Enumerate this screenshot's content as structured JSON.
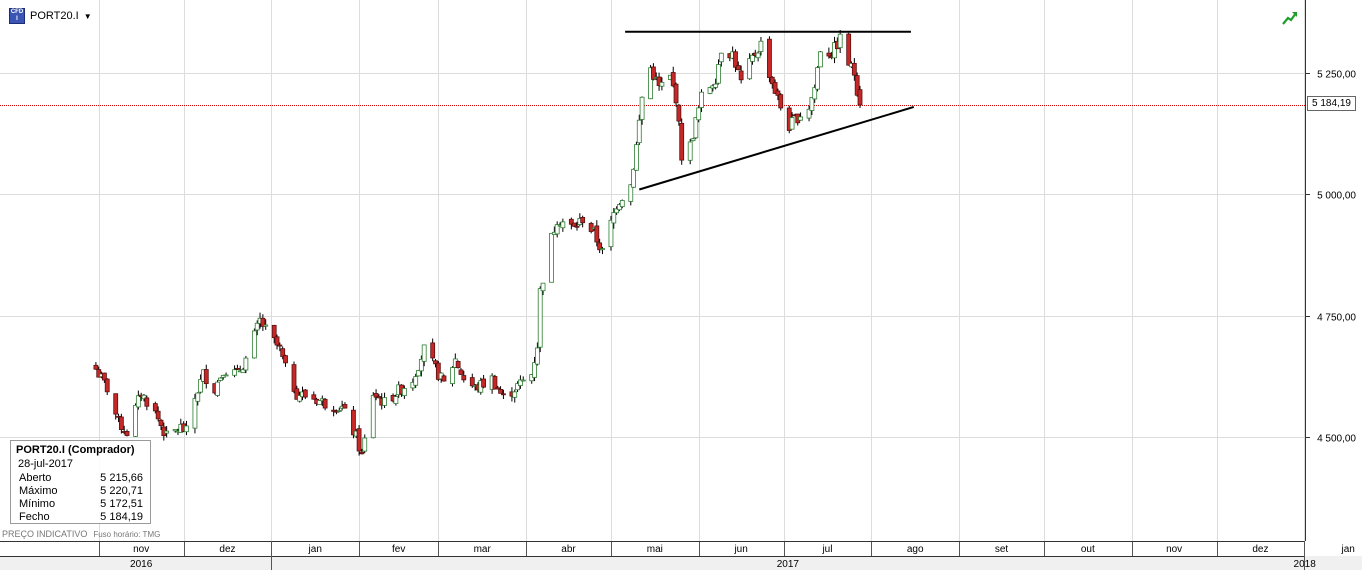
{
  "header": {
    "symbol": "PORT20.I",
    "icon": "cfd-instrument-icon",
    "caret": "▼"
  },
  "trend_icon": "green-trend-arrow-icon",
  "info_box": {
    "title": "PORT20.I (Comprador)",
    "date": "28-jul-2017",
    "rows": [
      {
        "label": "Aberto",
        "value": "5 215,66"
      },
      {
        "label": "Máximo",
        "value": "5 220,71"
      },
      {
        "label": "Mínimo",
        "value": "5 172,51"
      },
      {
        "label": "Fecho",
        "value": "5 184,19"
      }
    ]
  },
  "footer_note": "PREÇO INDICATIVO",
  "timezone_note": "Fuso horário: TMG",
  "current_price_label": "5 184,19",
  "colors": {
    "up": "#2e7d32",
    "down": "#c62828",
    "price_line": "#cc0000",
    "grid": "#dcdcdc"
  },
  "chart_data": {
    "type": "candlestick",
    "y_range": [
      4350,
      5380
    ],
    "y_ticks": [
      {
        "value": 4500,
        "label": "4 500,00"
      },
      {
        "value": 4750,
        "label": "4 750,00"
      },
      {
        "value": 5000,
        "label": "5 000,00"
      },
      {
        "value": 5250,
        "label": "5 250,00"
      }
    ],
    "month_labels": [
      "nov",
      "dez",
      "jan",
      "fev",
      "mar",
      "abr",
      "mai",
      "jun",
      "jul",
      "ago",
      "set",
      "out",
      "nov",
      "dez",
      "jan"
    ],
    "year_labels": [
      "2016",
      "2017",
      "2018"
    ],
    "current_price": 5184.19,
    "anchors": [
      [
        "2016-10-31",
        4640
      ],
      [
        "2016-11-04",
        4600
      ],
      [
        "2016-11-08",
        4530
      ],
      [
        "2016-11-11",
        4510
      ],
      [
        "2016-11-16",
        4590
      ],
      [
        "2016-11-21",
        4550
      ],
      [
        "2016-11-25",
        4500
      ],
      [
        "2016-11-30",
        4520
      ],
      [
        "2016-12-02",
        4510
      ],
      [
        "2016-12-05",
        4580
      ],
      [
        "2016-12-08",
        4630
      ],
      [
        "2016-12-12",
        4600
      ],
      [
        "2016-12-15",
        4640
      ],
      [
        "2016-12-20",
        4630
      ],
      [
        "2016-12-23",
        4660
      ],
      [
        "2016-12-28",
        4740
      ],
      [
        "2016-12-30",
        4720
      ],
      [
        "2017-01-04",
        4680
      ],
      [
        "2017-01-06",
        4640
      ],
      [
        "2017-01-10",
        4590
      ],
      [
        "2017-01-16",
        4580
      ],
      [
        "2017-01-20",
        4570
      ],
      [
        "2017-01-26",
        4560
      ],
      [
        "2017-01-31",
        4500
      ],
      [
        "2017-02-02",
        4460
      ],
      [
        "2017-02-06",
        4590
      ],
      [
        "2017-02-10",
        4570
      ],
      [
        "2017-02-14",
        4590
      ],
      [
        "2017-02-20",
        4620
      ],
      [
        "2017-02-24",
        4680
      ],
      [
        "2017-02-28",
        4640
      ],
      [
        "2017-03-03",
        4610
      ],
      [
        "2017-03-07",
        4660
      ],
      [
        "2017-03-10",
        4620
      ],
      [
        "2017-03-14",
        4600
      ],
      [
        "2017-03-20",
        4620
      ],
      [
        "2017-03-24",
        4580
      ],
      [
        "2017-03-28",
        4600
      ],
      [
        "2017-04-03",
        4630
      ],
      [
        "2017-04-05",
        4690
      ],
      [
        "2017-04-06",
        4800
      ],
      [
        "2017-04-10",
        4910
      ],
      [
        "2017-04-12",
        4950
      ],
      [
        "2017-04-18",
        4930
      ],
      [
        "2017-04-21",
        4950
      ],
      [
        "2017-04-25",
        4920
      ],
      [
        "2017-04-28",
        4880
      ],
      [
        "2017-05-03",
        4980
      ],
      [
        "2017-05-08",
        5020
      ],
      [
        "2017-05-10",
        5100
      ],
      [
        "2017-05-12",
        5200
      ],
      [
        "2017-05-15",
        5260
      ],
      [
        "2017-05-18",
        5220
      ],
      [
        "2017-05-22",
        5240
      ],
      [
        "2017-05-24",
        5200
      ],
      [
        "2017-05-26",
        5080
      ],
      [
        "2017-05-29",
        5100
      ],
      [
        "2017-05-31",
        5150
      ],
      [
        "2017-06-02",
        5200
      ],
      [
        "2017-06-07",
        5240
      ],
      [
        "2017-06-09",
        5300
      ],
      [
        "2017-06-13",
        5290
      ],
      [
        "2017-06-16",
        5230
      ],
      [
        "2017-06-20",
        5280
      ],
      [
        "2017-06-23",
        5310
      ],
      [
        "2017-06-27",
        5230
      ],
      [
        "2017-06-30",
        5180
      ],
      [
        "2017-07-03",
        5140
      ],
      [
        "2017-07-06",
        5160
      ],
      [
        "2017-07-10",
        5180
      ],
      [
        "2017-07-12",
        5220
      ],
      [
        "2017-07-14",
        5300
      ],
      [
        "2017-07-18",
        5290
      ],
      [
        "2017-07-21",
        5320
      ],
      [
        "2017-07-24",
        5270
      ],
      [
        "2017-07-26",
        5250
      ],
      [
        "2017-07-28",
        5184
      ]
    ],
    "annotations": {
      "resistance_line": {
        "from": [
          "2017-05-06",
          5335
        ],
        "to": [
          "2017-08-15",
          5335
        ]
      },
      "support_line": {
        "from": [
          "2017-05-11",
          5010
        ],
        "to": [
          "2017-08-16",
          5180
        ]
      }
    }
  }
}
